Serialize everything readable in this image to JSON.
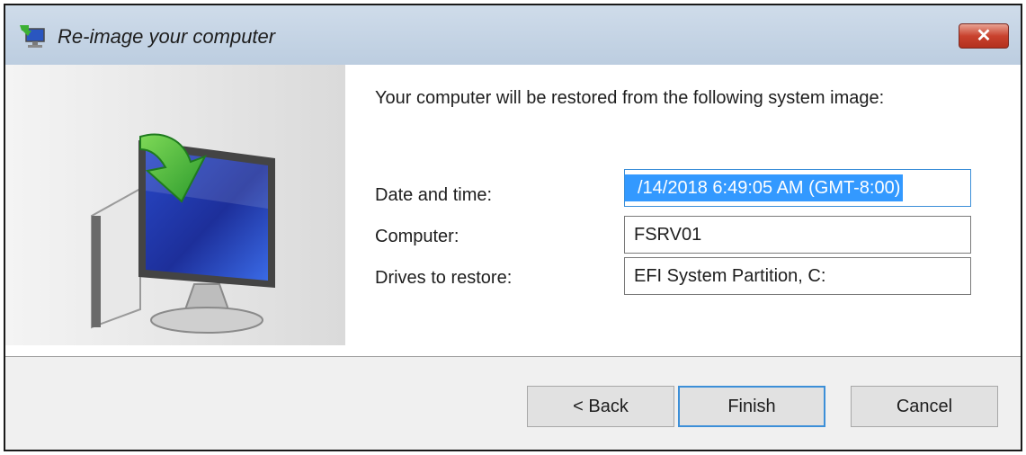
{
  "window": {
    "title": "Re-image your computer",
    "close_label": "✕"
  },
  "content": {
    "intro": "Your computer will be restored from the following system image:",
    "fields": [
      {
        "label": "Date and time:",
        "value": "/14/2018 6:49:05 AM (GMT-8:00)"
      },
      {
        "label": "Computer:",
        "value": "FSRV01"
      },
      {
        "label": "Drives to restore:",
        "value": "EFI System Partition, C:"
      }
    ]
  },
  "buttons": {
    "back": "< Back",
    "finish": "Finish",
    "cancel": "Cancel"
  },
  "colors": {
    "selection": "#3399ff",
    "focus_border": "#3c8fd8",
    "close_button": "#c9422e",
    "arrow": "#3cb034"
  },
  "icons": {
    "title": "restore-computer-icon",
    "illustration": "monitor-with-green-arrow-illustration",
    "close": "close-icon"
  }
}
